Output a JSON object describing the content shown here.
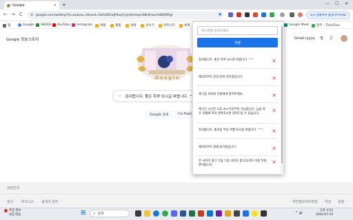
{
  "browser": {
    "tab_title": "Google",
    "tab_close": "×",
    "new_tab": "+",
    "address": "google.com/webhp?hl=ko&sa=X&ved=0ahUKEwjP4zqYyIyHAxVqm08HHaocA4BQPAgI",
    "must_update": "다시 실행하여 업데이트하세요",
    "back": "←",
    "forward": "→",
    "reload": "C",
    "star": "★"
  },
  "bookmarks": [
    {
      "label": "앱",
      "color": "#5f6368"
    },
    {
      "label": "Google",
      "color": "#4285f4"
    },
    {
      "label": "SW/EB",
      "color": "#1e8e3e"
    },
    {
      "label": "YouTube",
      "color": "#ff0000"
    },
    {
      "label": "Instagram",
      "color": "#c13584"
    },
    {
      "label": "여행",
      "color": "#f9ab00"
    },
    {
      "label": "제품",
      "color": "#f9ab00"
    },
    {
      "label": "개발",
      "color": "#f9ab00"
    },
    {
      "label": "글쓰기",
      "color": "#f9ab00"
    },
    {
      "label": "커뮤니티",
      "color": "#f9ab00"
    },
    {
      "label": "세계",
      "color": "#f9ab00"
    },
    {
      "label": "Google Meet",
      "color": "#00897b"
    },
    {
      "label": "업무 - TimeTree",
      "color": "#34a853"
    }
  ],
  "google": {
    "about": "Google 정보",
    "store": "스토어",
    "gmail": "Gmail",
    "images": "이미지",
    "search_placeholder": "검사합니다. 좋은 하루 되시길 바랍니다. ^^",
    "search_button": "Google 검색",
    "lucky_button": "I'm Feeling Lucky"
  },
  "footer": {
    "country": "대한민국",
    "ads": "광고",
    "business": "비즈니스",
    "how_search": "검색의 원리",
    "privacy": "개인정보처리방침",
    "terms": "약관",
    "settings": "설정"
  },
  "taskbar": {
    "weather_temp": "폭염 경보",
    "weather_desc": "낮음 맑음",
    "search": "검색",
    "time": "오후 4:53",
    "date": "2024-07-10"
  },
  "popup": {
    "input_placeholder": "텍스트를 입력하세요",
    "save_label": "저장",
    "delete_glyph": "×",
    "memos": [
      "감사합니다. 좋은 하루 되시길 바랍니다. ^^",
      "에러로부터 문의 연락 대기중입니다.",
      "재 1층 로비의 직원에게 알려주세요.",
      "체크인 시간은 오후 4시 이후부터 가능합니다. 늦을 경우 호텔에 미리 연락하시면 알려드릴 수 있습니다.",
      "감사합니다. 즐거운 부산 여행 되시길 바랍니다. ^^",
      "에러로부터 결제 대기중입니다.",
      "본 사이즈 링크 다음 다음 사이즈 참고(1개가 이용 5개) 준비됩니다."
    ]
  }
}
